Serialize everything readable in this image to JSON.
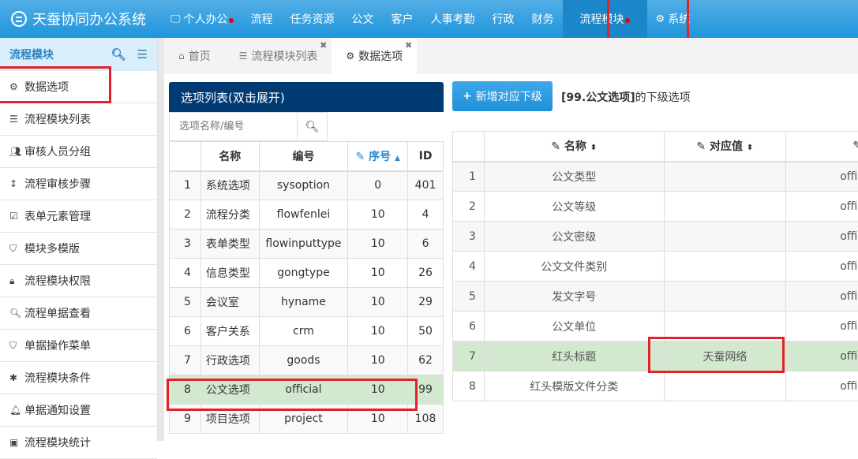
{
  "app": {
    "title": "天蚕协同办公系统"
  },
  "nav": [
    {
      "label": "个人办公",
      "icon": "monitor-icon",
      "dot": true
    },
    {
      "label": "流程"
    },
    {
      "label": "任务资源"
    },
    {
      "label": "公文"
    },
    {
      "label": "客户"
    },
    {
      "label": "人事考勤"
    },
    {
      "label": "行政"
    },
    {
      "label": "财务"
    },
    {
      "label": "流程模块",
      "dot": true,
      "active": true
    },
    {
      "label": "系统",
      "icon": "gear-icon"
    }
  ],
  "sidebar": {
    "title": "流程模块",
    "items": [
      {
        "label": "数据选项",
        "icon": "gear-icon"
      },
      {
        "label": "流程模块列表",
        "icon": "list-icon"
      },
      {
        "label": "审核人员分组",
        "icon": "users-icon"
      },
      {
        "label": "流程审核步骤",
        "icon": "arrows-vertical-icon"
      },
      {
        "label": "表单元素管理",
        "icon": "checkbox-icon"
      },
      {
        "label": "模块多模版",
        "icon": "bookmark-icon"
      },
      {
        "label": "流程模块权限",
        "icon": "lock-icon"
      },
      {
        "label": "流程单据查看",
        "icon": "search-icon"
      },
      {
        "label": "单据操作菜单",
        "icon": "bookmark-icon"
      },
      {
        "label": "流程模块条件",
        "icon": "asterisk-icon"
      },
      {
        "label": "单据通知设置",
        "icon": "bell-icon"
      },
      {
        "label": "流程模块统计",
        "icon": "chart-icon"
      }
    ]
  },
  "tabs": [
    {
      "label": "首页",
      "icon": "home-icon"
    },
    {
      "label": "流程模块列表",
      "icon": "list-icon",
      "closable": true
    },
    {
      "label": "数据选项",
      "icon": "gear-icon",
      "closable": true,
      "active": true
    }
  ],
  "options_panel": {
    "title": "选项列表(双击展开)",
    "search_placeholder": "选项名称/编号",
    "columns": [
      "",
      "名称",
      "编号",
      "序号",
      "ID"
    ],
    "rows": [
      {
        "idx": "1",
        "name": "系统选项",
        "code": "sysoption",
        "sort": "0",
        "id": "401"
      },
      {
        "idx": "2",
        "name": "流程分类",
        "code": "flowfenlei",
        "sort": "10",
        "id": "4"
      },
      {
        "idx": "3",
        "name": "表单类型",
        "code": "flowinputtype",
        "sort": "10",
        "id": "6"
      },
      {
        "idx": "4",
        "name": "信息类型",
        "code": "gongtype",
        "sort": "10",
        "id": "26"
      },
      {
        "idx": "5",
        "name": "会议室",
        "code": "hyname",
        "sort": "10",
        "id": "29"
      },
      {
        "idx": "6",
        "name": "客户关系",
        "code": "crm",
        "sort": "10",
        "id": "50"
      },
      {
        "idx": "7",
        "name": "行政选项",
        "code": "goods",
        "sort": "10",
        "id": "62"
      },
      {
        "idx": "8",
        "name": "公文选项",
        "code": "official",
        "sort": "10",
        "id": "99",
        "selected": true
      },
      {
        "idx": "9",
        "name": "项目选项",
        "code": "project",
        "sort": "10",
        "id": "108"
      }
    ]
  },
  "sub_panel": {
    "add_button": "新增对应下级",
    "title_bold": "[99.公文选项]",
    "title_rest": "的下级选项",
    "columns": [
      "",
      "名称",
      "对应值",
      ""
    ],
    "rows": [
      {
        "idx": "1",
        "name": "公文类型",
        "value": "",
        "extra": "official"
      },
      {
        "idx": "2",
        "name": "公文等级",
        "value": "",
        "extra": "official"
      },
      {
        "idx": "3",
        "name": "公文密级",
        "value": "",
        "extra": "official"
      },
      {
        "idx": "4",
        "name": "公文文件类别",
        "value": "",
        "extra": "official"
      },
      {
        "idx": "5",
        "name": "发文字号",
        "value": "",
        "extra": "official"
      },
      {
        "idx": "6",
        "name": "公文单位",
        "value": "",
        "extra": "official"
      },
      {
        "idx": "7",
        "name": "红头标题",
        "value": "天蚕网络",
        "extra": "official",
        "selected": true
      },
      {
        "idx": "8",
        "name": "红头模版文件分类",
        "value": "",
        "extra": "official"
      }
    ]
  },
  "colors": {
    "topbar": "#2a9ee0",
    "panel_header": "#003a73",
    "selected_row": "#d3e9cf",
    "highlight": "#e2212a"
  }
}
